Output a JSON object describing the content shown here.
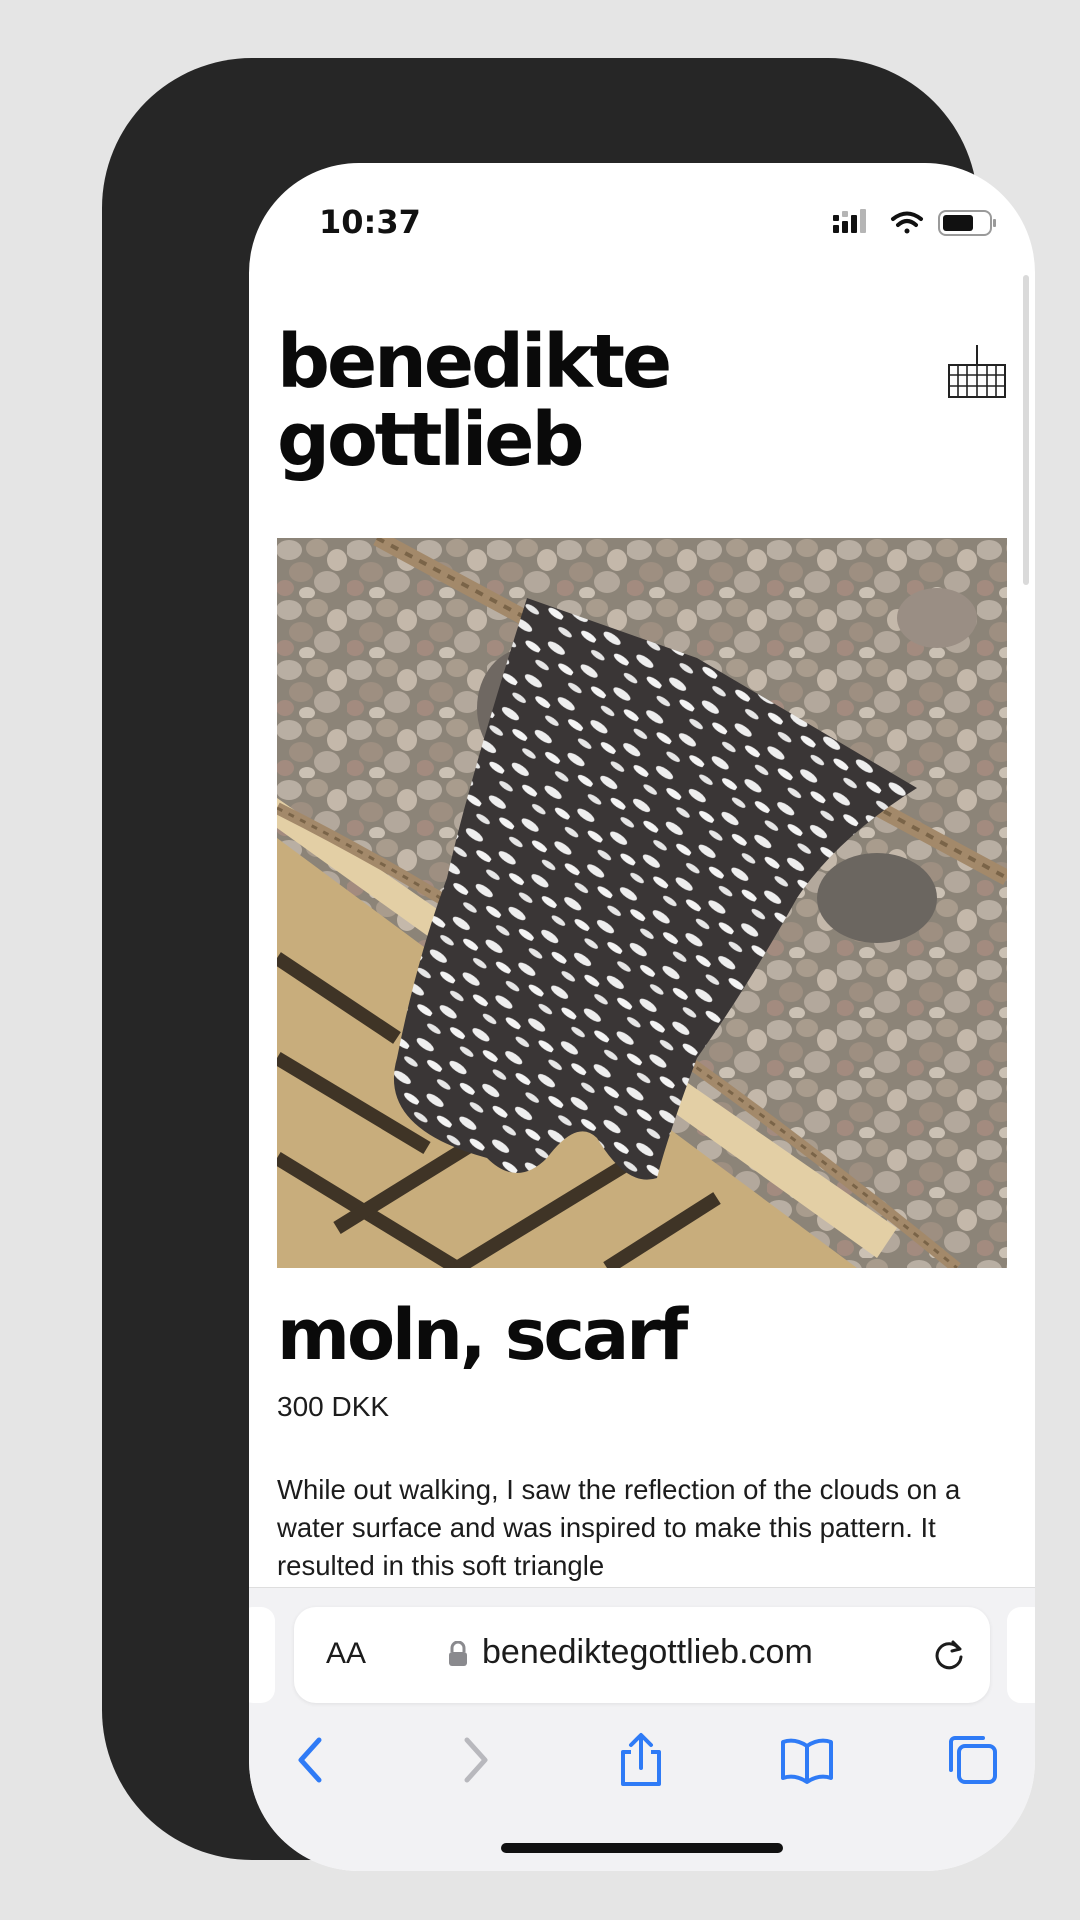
{
  "status_bar": {
    "time": "10:37"
  },
  "site": {
    "brand_line1": "benedikte",
    "brand_line2": "gottlieb"
  },
  "product": {
    "title": "moln, scarf",
    "price": "300 DKK",
    "description": "While out walking, I saw the reflection of the clouds on a water surface and was inspired to make this pattern. It resulted in this soft triangle"
  },
  "browser": {
    "text_size_label": "AA",
    "url": "benediktegottlieb.com"
  },
  "colors": {
    "accent": "#2f7bf6",
    "disabled": "#b8b8bd",
    "text": "#0a0a0a"
  },
  "icons": [
    "signal-icon",
    "wifi-icon",
    "battery-icon",
    "menu-grid-icon",
    "lock-icon",
    "reload-icon",
    "back-icon",
    "forward-icon",
    "share-icon",
    "bookmarks-icon",
    "tabs-icon"
  ]
}
